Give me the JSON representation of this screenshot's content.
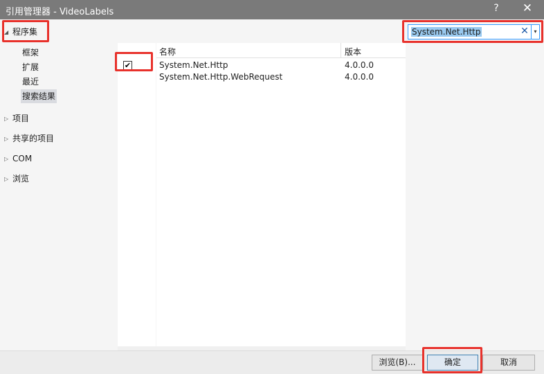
{
  "window": {
    "title": "引用管理器 - VideoLabels",
    "help": "?",
    "close": "✕"
  },
  "sidebar": {
    "assemblies": {
      "expander": "◢",
      "label": "程序集"
    },
    "sub_items": [
      {
        "label": "框架",
        "selected": false
      },
      {
        "label": "扩展",
        "selected": false
      },
      {
        "label": "最近",
        "selected": false
      },
      {
        "label": "搜索结果",
        "selected": true
      }
    ],
    "sections": [
      {
        "expander": "▷",
        "label": "项目"
      },
      {
        "expander": "▷",
        "label": "共享的项目"
      },
      {
        "expander": "▷",
        "label": "COM"
      },
      {
        "expander": "▷",
        "label": "浏览"
      }
    ]
  },
  "list": {
    "headers": {
      "name": "名称",
      "version": "版本"
    },
    "rows": [
      {
        "checked": true,
        "name": "System.Net.Http",
        "version": "4.0.0.0"
      },
      {
        "checked": false,
        "name": "System.Net.Http.WebRequest",
        "version": "4.0.0.0"
      }
    ],
    "check_glyph": "✔"
  },
  "search": {
    "value": "System.Net.Http",
    "clear_icon": "✕",
    "dropdown_icon": "▾"
  },
  "footer": {
    "browse_label": "浏览(B)...",
    "ok_label": "确定",
    "cancel_label": "取消"
  },
  "colors": {
    "titlebar": "#7a7a7a",
    "highlight": "#e8312b",
    "accent": "#3399ff",
    "selection": "#99c9ef"
  }
}
